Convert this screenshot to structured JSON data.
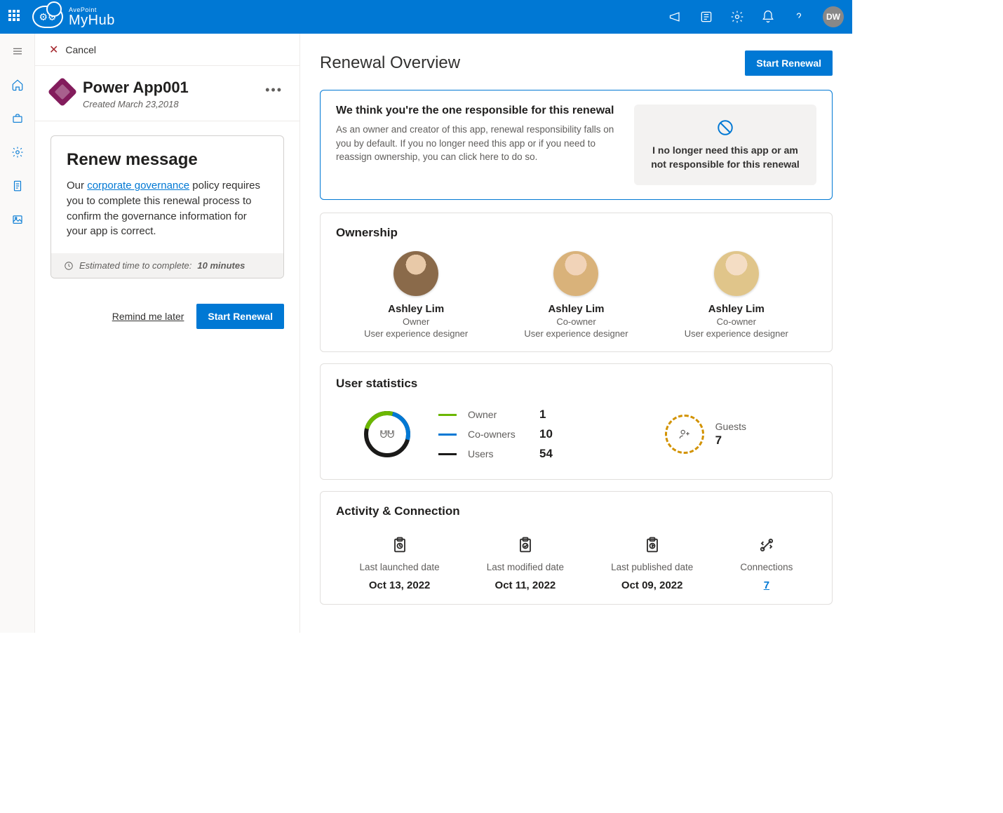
{
  "topbar": {
    "brand_small": "AvePoint",
    "brand_big": "MyHub",
    "avatar_initials": "DW"
  },
  "cancel_label": "Cancel",
  "app": {
    "title": "Power App001",
    "created_label": "Created March 23,2018"
  },
  "renew": {
    "title": "Renew message",
    "pre": "Our ",
    "link": "corporate governance",
    "post": " policy requires you to complete this renewal process to confirm the governance information for your app is correct.",
    "eta_label": "Estimated time to complete:",
    "eta_value": "10 minutes",
    "remind_label": "Remind me later",
    "start_label": "Start Renewal"
  },
  "main": {
    "title": "Renewal Overview",
    "start_button": "Start Renewal"
  },
  "banner": {
    "title": "We think you're the one responsible for this renewal",
    "text": "As an owner and creator of this app, renewal responsibility falls on you by default. If you no longer need this app or if you need to reassign ownership, you can click here to do so.",
    "right_text": "I no longer need this app or am not responsible for this renewal"
  },
  "ownership": {
    "title": "Ownership",
    "people": [
      {
        "name": "Ashley Lim",
        "role": "Owner",
        "title": "User experience designer"
      },
      {
        "name": "Ashley Lim",
        "role": "Co-owner",
        "title": "User experience designer"
      },
      {
        "name": "Ashley Lim",
        "role": "Co-owner",
        "title": "User experience designer"
      }
    ]
  },
  "stats": {
    "title": "User statistics",
    "rows": [
      {
        "label": "Owner",
        "value": "1",
        "color": "#6bb700"
      },
      {
        "label": "Co-owners",
        "value": "10",
        "color": "#0078d4"
      },
      {
        "label": "Users",
        "value": "54",
        "color": "#1b1a19"
      }
    ],
    "guests_label": "Guests",
    "guests_value": "7"
  },
  "activity": {
    "title": "Activity & Connection",
    "items": [
      {
        "label": "Last launched date",
        "value": "Oct 13, 2022"
      },
      {
        "label": "Last modified date",
        "value": "Oct 11, 2022"
      },
      {
        "label": "Last published date",
        "value": "Oct 09, 2022"
      },
      {
        "label": "Connections",
        "value": "7",
        "is_link": true
      }
    ]
  }
}
